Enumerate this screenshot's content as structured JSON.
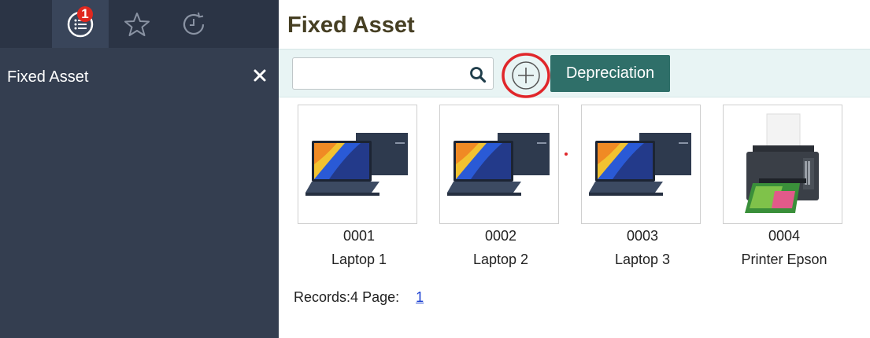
{
  "sidebar": {
    "tabs": [
      {
        "icon": "list-icon",
        "badge": "1"
      },
      {
        "icon": "star-icon"
      },
      {
        "icon": "history-icon"
      }
    ],
    "title": "Fixed Asset",
    "close_icon": "close-icon"
  },
  "main": {
    "title": "Fixed Asset",
    "search": {
      "value": "",
      "placeholder": ""
    },
    "add_button_icon": "plus-circle-icon",
    "depreciation_label": "Depreciation",
    "assets": [
      {
        "code": "0001",
        "name": "Laptop 1",
        "image": "laptop-image"
      },
      {
        "code": "0002",
        "name": "Laptop 2",
        "image": "laptop-image"
      },
      {
        "code": "0003",
        "name": "Laptop 3",
        "image": "laptop-image"
      },
      {
        "code": "0004",
        "name": "Printer Epson",
        "image": "printer-image"
      }
    ],
    "pagination": {
      "records_label": "Records:4",
      "page_label": "Page:",
      "page": "1"
    }
  },
  "colors": {
    "sidebar": "#343e50",
    "accent": "#2f6f69",
    "title": "#463f23",
    "badge": "#e0281f",
    "highlight": "#e0262a"
  }
}
